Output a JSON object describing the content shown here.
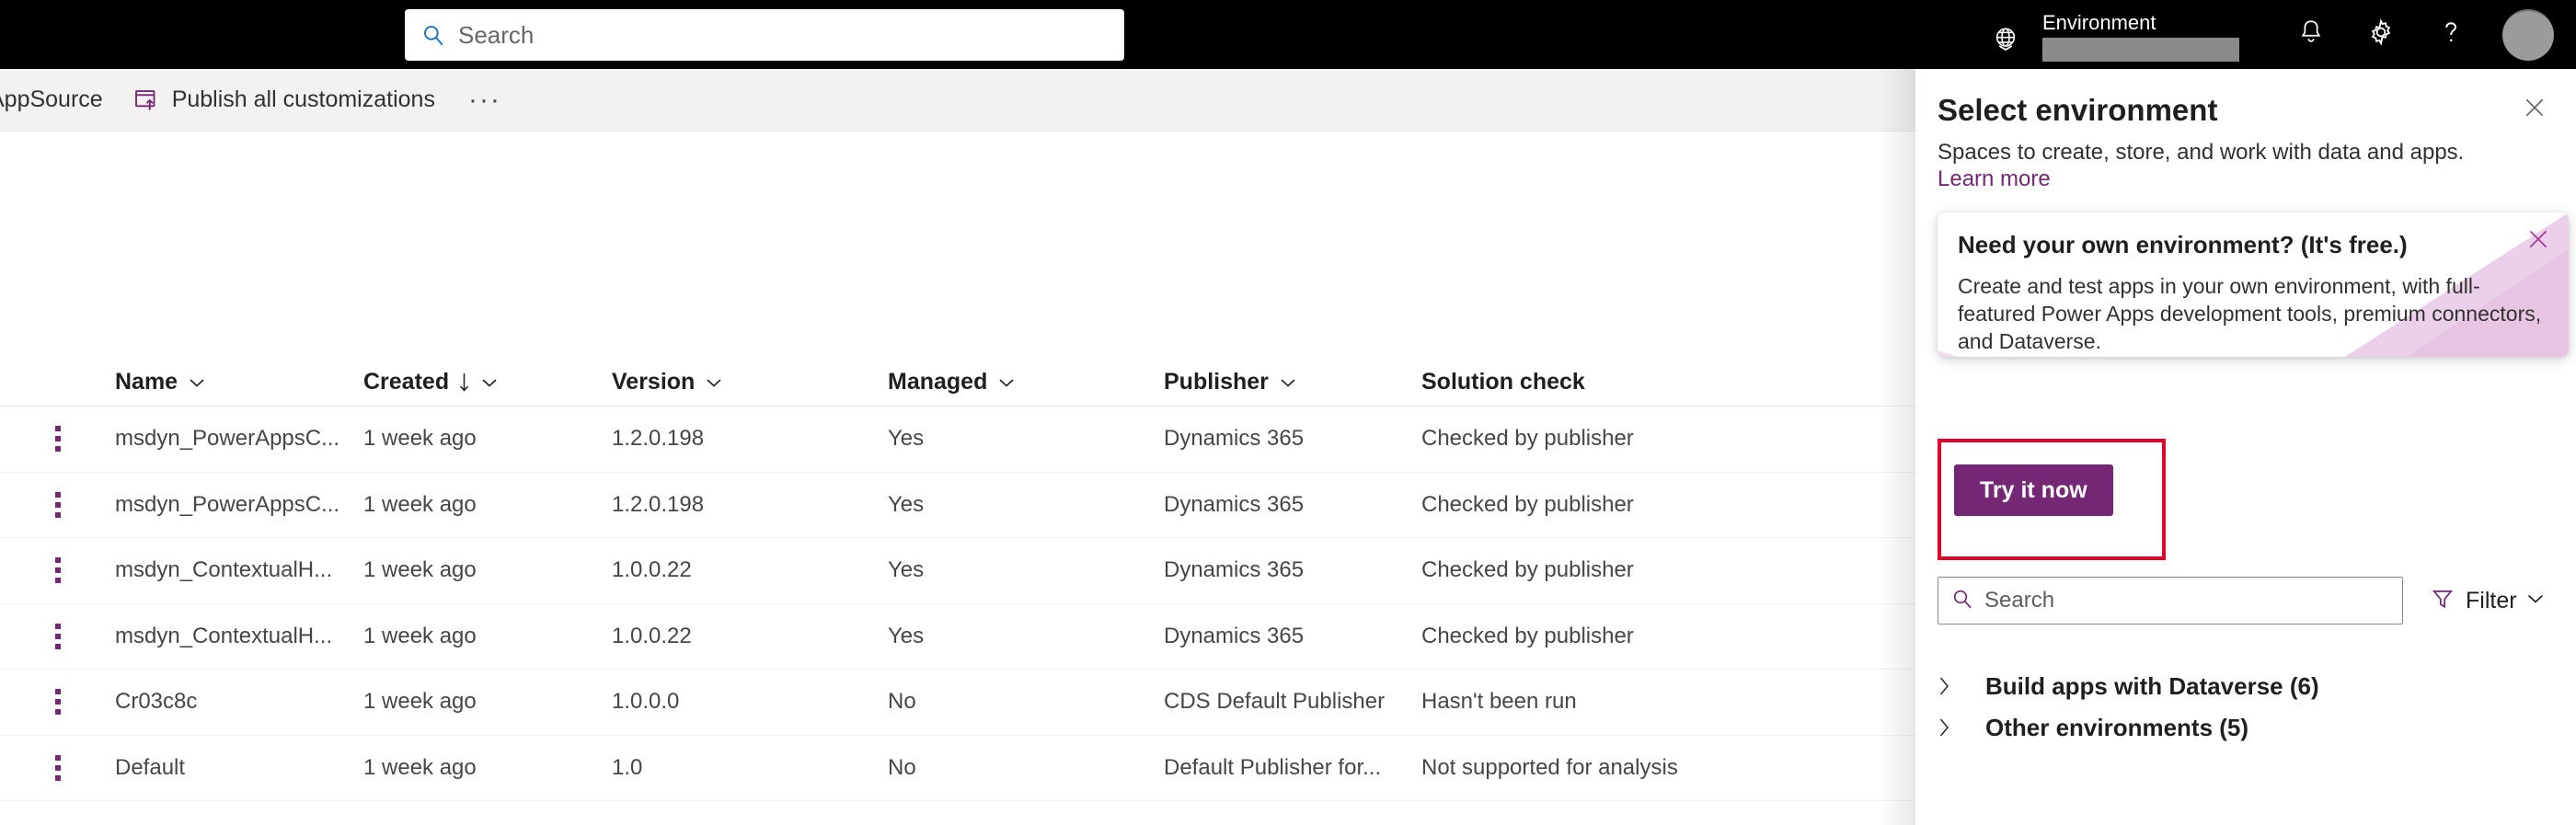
{
  "suitebar": {
    "search_placeholder": "Search",
    "environment_label": "Environment",
    "environment_value_redacted": true,
    "icons": {
      "globe": "globe-icon",
      "notification": "bell-icon",
      "settings": "gear-icon",
      "help": "question-mark-icon",
      "account": "avatar"
    }
  },
  "commandbar": {
    "appsource_label": "AppSource",
    "publish_label": "Publish all customizations",
    "overflow_label": "···"
  },
  "grid": {
    "columns": [
      {
        "label": "Name",
        "sortable": true,
        "sorted": false
      },
      {
        "label": "Created",
        "sortable": true,
        "sorted": true,
        "sort_direction": "descending"
      },
      {
        "label": "Version",
        "sortable": true,
        "sorted": false
      },
      {
        "label": "Managed",
        "sortable": true,
        "sorted": false
      },
      {
        "label": "Publisher",
        "sortable": true,
        "sorted": false
      },
      {
        "label": "Solution check",
        "sortable": false,
        "sorted": false
      }
    ],
    "rows": [
      {
        "name": "msdyn_PowerAppsC...",
        "created": "1 week ago",
        "version": "1.2.0.198",
        "managed": "Yes",
        "publisher": "Dynamics 365",
        "check": "Checked by publisher"
      },
      {
        "name": "msdyn_PowerAppsC...",
        "created": "1 week ago",
        "version": "1.2.0.198",
        "managed": "Yes",
        "publisher": "Dynamics 365",
        "check": "Checked by publisher"
      },
      {
        "name": "msdyn_ContextualH...",
        "created": "1 week ago",
        "version": "1.0.0.22",
        "managed": "Yes",
        "publisher": "Dynamics 365",
        "check": "Checked by publisher"
      },
      {
        "name": "msdyn_ContextualH...",
        "created": "1 week ago",
        "version": "1.0.0.22",
        "managed": "Yes",
        "publisher": "Dynamics 365",
        "check": "Checked by publisher"
      },
      {
        "name": "Cr03c8c",
        "created": "1 week ago",
        "version": "1.0.0.0",
        "managed": "No",
        "publisher": "CDS Default Publisher",
        "check": "Hasn't been run"
      },
      {
        "name": "Default",
        "created": "1 week ago",
        "version": "1.0",
        "managed": "No",
        "publisher": "Default Publisher for...",
        "check": "Not supported for analysis"
      }
    ]
  },
  "panel": {
    "title": "Select environment",
    "subtitle": "Spaces to create, store, and work with data and apps.",
    "learn_more": "Learn more",
    "callout": {
      "title": "Need your own environment? (It's free.)",
      "body": "Create and test apps in your own environment, with full-featured Power Apps development tools, premium connectors, and Dataverse.",
      "button_label": "Try it now",
      "highlighted": true
    },
    "search_placeholder": "Search",
    "filter_label": "Filter",
    "groups": [
      {
        "label": "Build apps with Dataverse (6)",
        "expanded": false
      },
      {
        "label": "Other environments (5)",
        "expanded": false
      }
    ]
  },
  "colors": {
    "brand_purple": "#742774",
    "suitebar_black": "#000000",
    "commandbar_gray": "#f3f2f1",
    "highlight_red": "#e3002b",
    "callout_pink": "#e8c9e4"
  }
}
